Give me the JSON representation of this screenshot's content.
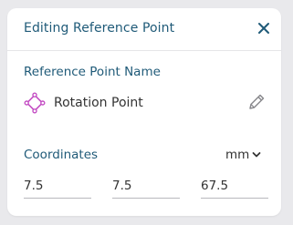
{
  "panel": {
    "title": "Editing Reference Point",
    "close_icon": "close-icon"
  },
  "reference_point": {
    "section_label": "Reference Point Name",
    "icon": "reference-point-icon",
    "name": "Rotation Point",
    "edit_icon": "pencil-icon"
  },
  "coordinates": {
    "section_label": "Coordinates",
    "unit": "mm",
    "values": [
      "7.5",
      "7.5",
      "67.5"
    ]
  },
  "colors": {
    "accent": "#1f5a78",
    "icon_accent": "#c44fc4",
    "text": "#333333",
    "divider": "#e6e6e8",
    "input_underline": "#b9b9bd"
  }
}
